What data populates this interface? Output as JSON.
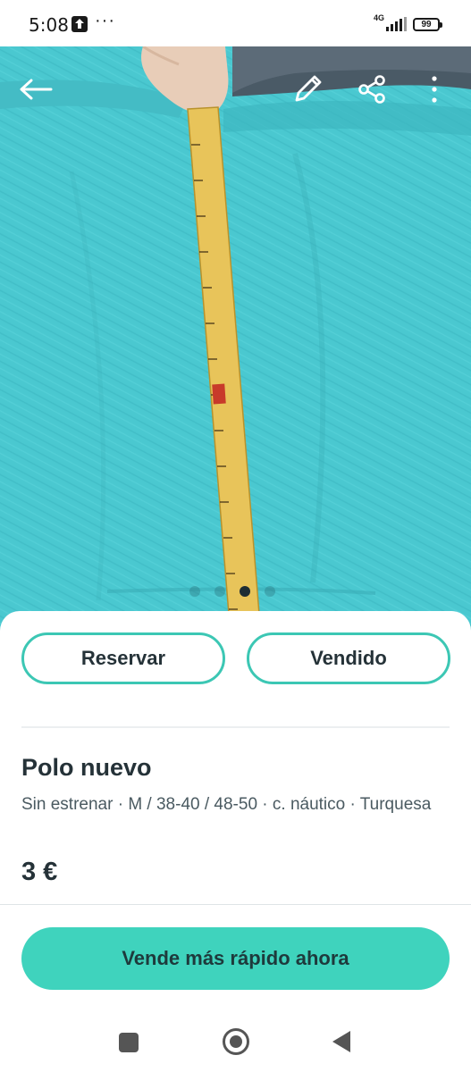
{
  "status_bar": {
    "time": "5:08",
    "more": "···",
    "network": "4G",
    "battery": "99"
  },
  "photo": {
    "icons": [
      "back-arrow-icon",
      "edit-pencil-icon",
      "share-icon",
      "more-vertical-icon"
    ],
    "carousel": {
      "total": 4,
      "active_index": 2
    },
    "colors": {
      "fabric": "#49c7cf",
      "tape": "#e8c45a"
    }
  },
  "actions": {
    "reserve_label": "Reservar",
    "sold_label": "Vendido"
  },
  "product": {
    "title": "Polo nuevo",
    "attributes": "Sin estrenar · M / 38-40 / 48-50 · c. náutico  ·  Turquesa",
    "price": "3 €"
  },
  "cta": {
    "label": "Vende más rápido ahora"
  },
  "colors": {
    "accent": "#3cc7b4",
    "cta_fill": "#3fd3bd",
    "text": "#253238"
  }
}
